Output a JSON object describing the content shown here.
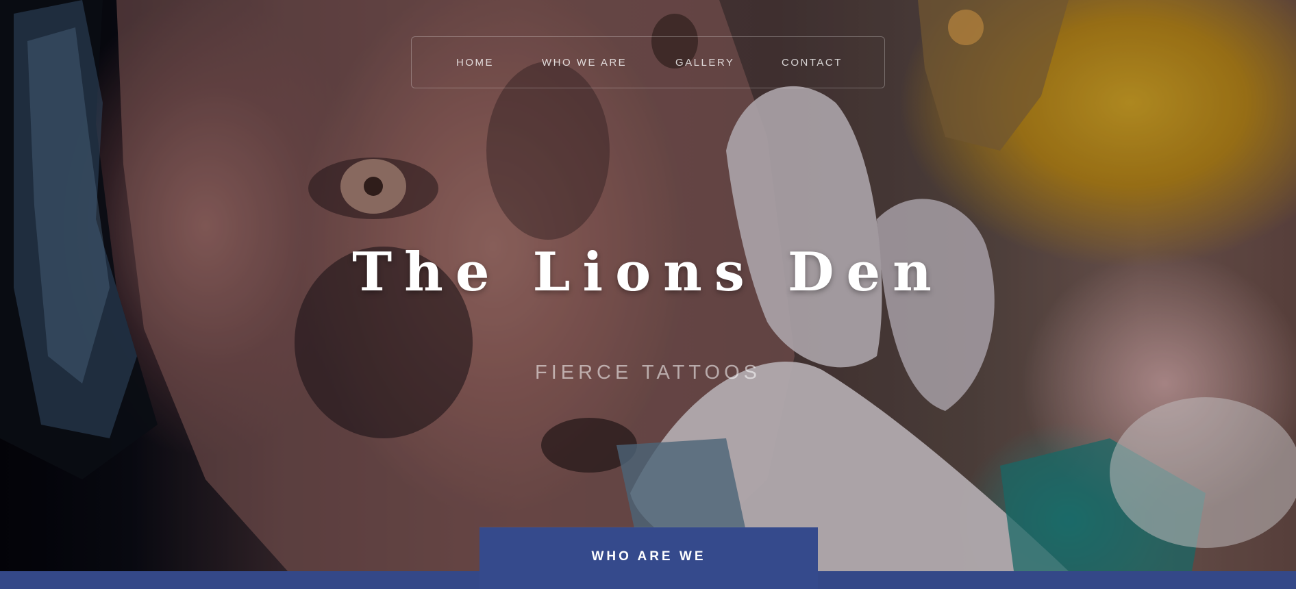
{
  "nav": {
    "items": [
      {
        "label": "HOME"
      },
      {
        "label": "WHO WE ARE"
      },
      {
        "label": "GALLERY"
      },
      {
        "label": "CONTACT"
      }
    ]
  },
  "hero": {
    "title": "The Lions Den",
    "subtitle": "FIERCE TATTOOS",
    "background": "photo of a lion face tattoo being worked on by gloved hands"
  },
  "cta": {
    "label": "WHO ARE WE"
  },
  "colors": {
    "accent": "#354a8c",
    "title": "#ffffff"
  }
}
